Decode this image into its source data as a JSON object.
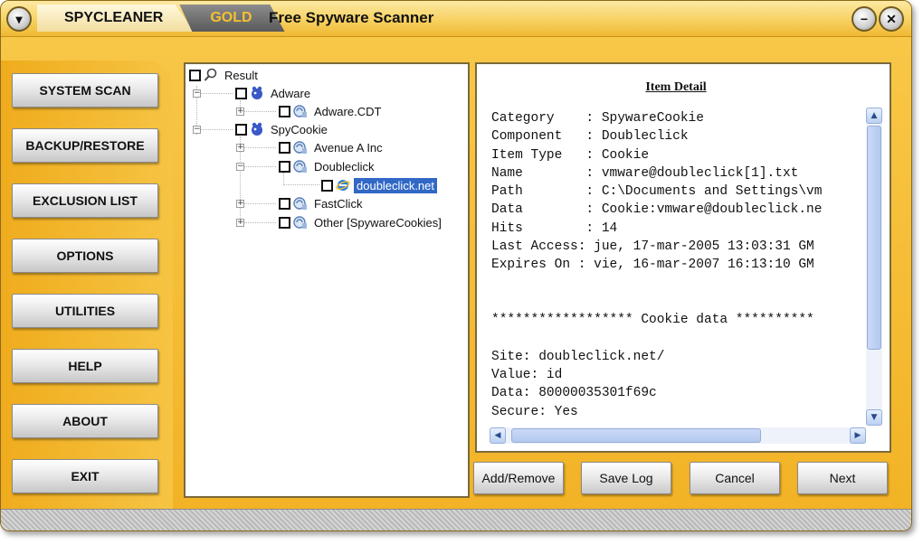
{
  "app": {
    "brand": "SPYCLEANER",
    "edition": "GOLD",
    "title": "Free Spyware Scanner"
  },
  "window_buttons": {
    "menu": "▾",
    "minimize": "−",
    "close": "✕"
  },
  "sidebar": {
    "items": [
      {
        "label": "SYSTEM SCAN"
      },
      {
        "label": "BACKUP/RESTORE"
      },
      {
        "label": "EXCLUSION LIST"
      },
      {
        "label": "OPTIONS"
      },
      {
        "label": "UTILITIES"
      },
      {
        "label": "HELP"
      },
      {
        "label": "ABOUT"
      },
      {
        "label": "EXIT"
      }
    ]
  },
  "tree": {
    "root": "Result",
    "nodes": [
      {
        "label": "Adware"
      },
      {
        "label": "Adware.CDT"
      },
      {
        "label": "SpyCookie"
      },
      {
        "label": "Avenue A Inc"
      },
      {
        "label": "Doubleclick"
      },
      {
        "label": "doubleclick.net"
      },
      {
        "label": "FastClick"
      },
      {
        "label": "Other [SpywareCookies]"
      }
    ],
    "selected": "doubleclick.net"
  },
  "detail": {
    "heading": "Item Detail",
    "lines": [
      "Category    : SpywareCookie",
      "Component   : Doubleclick",
      "Item Type   : Cookie",
      "Name        : vmware@doubleclick[1].txt",
      "Path        : C:\\Documents and Settings\\vm",
      "Data        : Cookie:vmware@doubleclick.ne",
      "Hits        : 14",
      "Last Access: jue, 17-mar-2005 13:03:31 GM",
      "Expires On : vie, 16-mar-2007 16:13:10 GM",
      "",
      "",
      "****************** Cookie data **********",
      "",
      "Site: doubleclick.net/",
      "Value: id",
      "Data: 80000035301f69c",
      "Secure: Yes"
    ]
  },
  "actions": {
    "add_remove": "Add/Remove",
    "save_log": "Save Log",
    "cancel": "Cancel",
    "next": "Next"
  },
  "colors": {
    "frame": "#f2b224",
    "sidebar": "#efac1d",
    "selection": "#3168c6"
  }
}
